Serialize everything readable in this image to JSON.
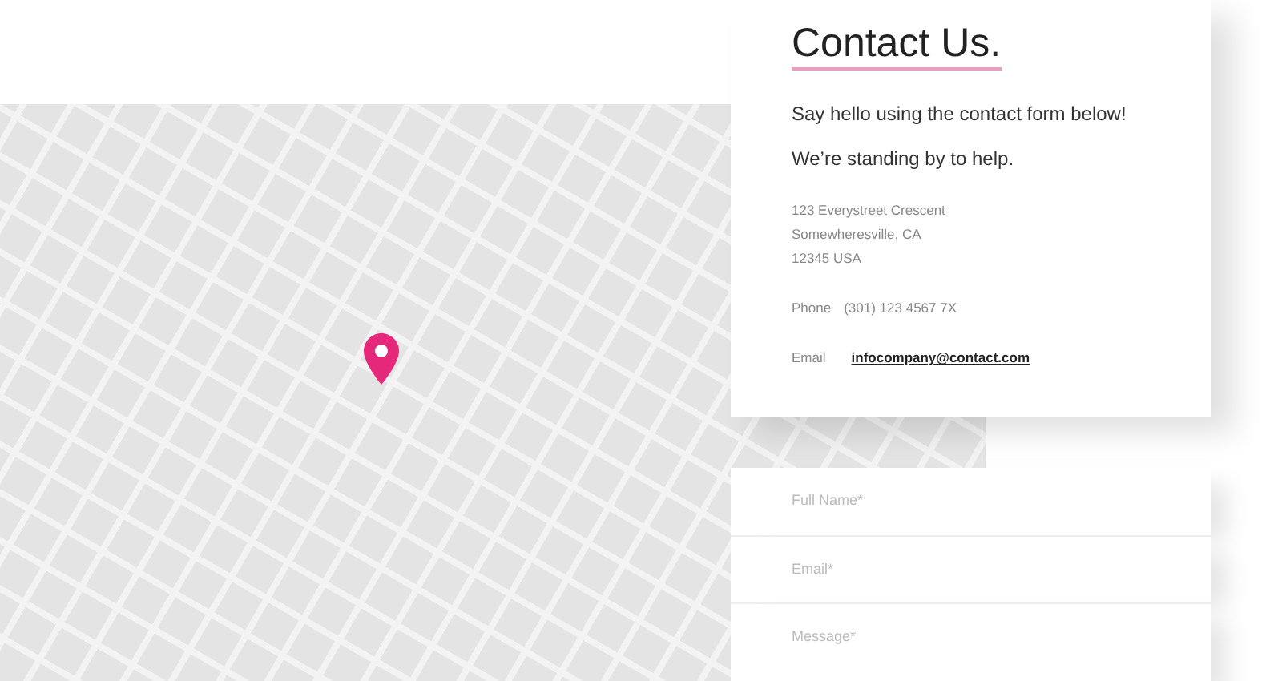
{
  "contact": {
    "title": "Contact Us.",
    "intro": [
      "Say hello using the contact form below!",
      "We’re standing by to help."
    ],
    "address": [
      "123 Everystreet Crescent",
      "Somewheresville, CA",
      "12345 USA"
    ],
    "phone": {
      "label": "Phone",
      "value": "(301) 123 4567 7X"
    },
    "email": {
      "label": "Email",
      "value": "infocompany@contact.com"
    }
  },
  "form": {
    "fields": [
      {
        "placeholder": "Full Name*",
        "kind": "input"
      },
      {
        "placeholder": "Email*",
        "kind": "input"
      },
      {
        "placeholder": "Message*",
        "kind": "textarea"
      }
    ]
  }
}
